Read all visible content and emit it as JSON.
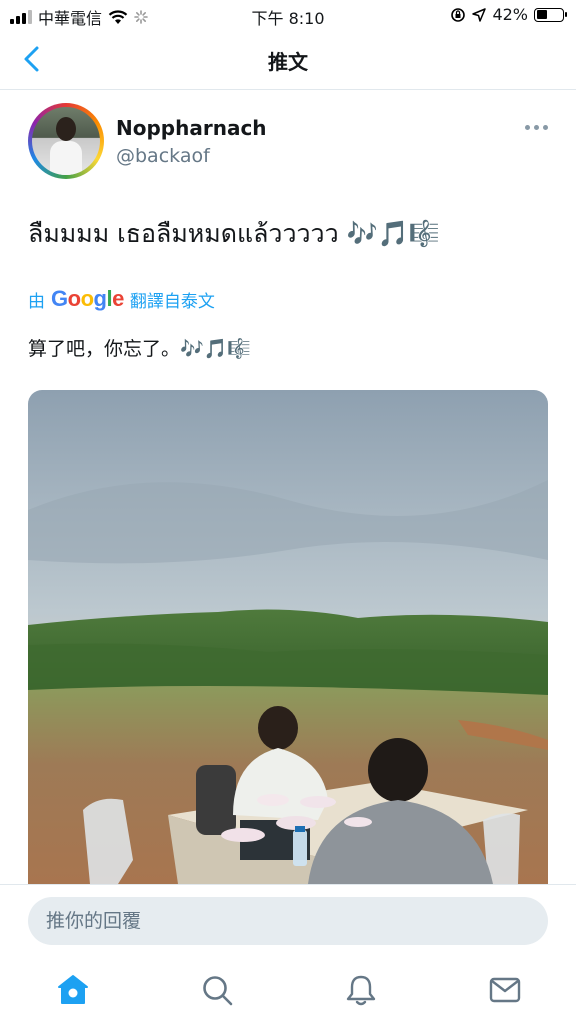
{
  "status_bar": {
    "carrier": "中華電信",
    "time": "下午 8:10",
    "battery": "42%",
    "battery_level": 0.42
  },
  "header": {
    "title": "推文"
  },
  "tweet": {
    "display_name": "Noppharnach",
    "username": "@backaof",
    "text": "ลืมมมม เธอลืมหมดแล้ววววว 🎶🎵🎼",
    "translation": {
      "by": "由",
      "provider": "Google",
      "label": "翻譯自泰文",
      "text": "算了吧，你忘了。🎶🎵🎼"
    }
  },
  "reply": {
    "placeholder": "推你的回覆"
  },
  "colors": {
    "accent": "#1da1f2",
    "secondary_text": "#657786",
    "divider": "#e1e8ed"
  },
  "icons": {
    "back": "chevron-left-icon",
    "more": "more-horizontal-icon",
    "tabs": [
      "home-icon",
      "search-icon",
      "notifications-icon",
      "messages-icon"
    ]
  }
}
